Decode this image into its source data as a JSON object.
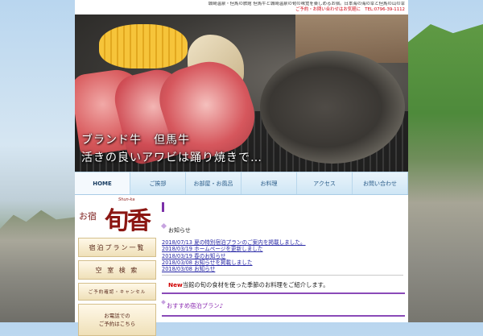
{
  "header": {
    "line1": "城崎温泉・但馬の旅館 但馬牛と城崎温泉の旬の味覚を楽しめるお宿。日本海の海の幸と但馬の山の幸",
    "line2": "ご予約・お問い合わせはお気軽に　TEL:0796-39-1112"
  },
  "hero": {
    "text_line1": "ブランド牛　但馬牛",
    "text_line2": "活きの良いアワビは踊り焼きで…"
  },
  "nav": {
    "items": [
      {
        "label": "HOME"
      },
      {
        "label": "ご挨拶"
      },
      {
        "label": "お部屋・お風呂"
      },
      {
        "label": "お料理"
      },
      {
        "label": "アクセス"
      },
      {
        "label": "お問い合わせ"
      }
    ]
  },
  "sidebar": {
    "logo_small": "お宿",
    "logo_big": "旬香",
    "logo_ruby": "Shun-ka",
    "buttons": [
      {
        "label": "宿泊プラン一覧"
      },
      {
        "label": "空 室 検 索"
      },
      {
        "label": "ご予約確認・キャンセル"
      }
    ],
    "phone_label_1": "お電話での",
    "phone_label_2": "ご予約はこちら"
  },
  "main": {
    "news_heading": "お知らせ",
    "news": [
      {
        "text": "2018/07/13 夏の特別宿泊プランのご案内を掲載しました。"
      },
      {
        "text": "2018/03/19 ホームページを更新しました"
      },
      {
        "text": "2018/03/19 春のお知らせ"
      },
      {
        "text": "2018/03/08 お知らせを掲載しました"
      },
      {
        "text": "2018/03/08 お知らせ"
      }
    ],
    "new_badge": "New",
    "new_text": "当館の旬の食材を使った季節のお料理をご紹介します。",
    "section_title": "おすすめ宿泊プラン♪"
  }
}
